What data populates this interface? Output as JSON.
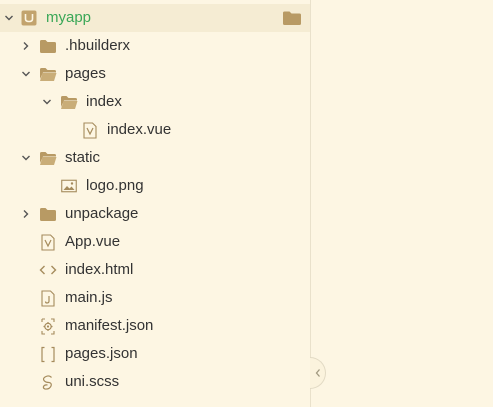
{
  "project": {
    "name": "myapp"
  },
  "tree": {
    "hbuilderx": ".hbuilderx",
    "pages": "pages",
    "index_folder": "index",
    "index_vue": "index.vue",
    "static": "static",
    "logo": "logo.png",
    "unpackage": "unpackage",
    "app_vue": "App.vue",
    "index_html": "index.html",
    "main_js": "main.js",
    "manifest": "manifest.json",
    "pages_json": "pages.json",
    "uni_scss": "uni.scss"
  },
  "colors": {
    "background": "#fdf6e3",
    "root_highlight": "#f5ecd3",
    "project_name": "#3aa757",
    "folder": "#b89a64",
    "file_icon": "#a58b5c"
  },
  "icons": {
    "root": "uniapp-project-icon",
    "folder": "folder-icon",
    "vue": "vue-file-icon",
    "image": "image-file-icon",
    "html": "code-file-icon",
    "js": "js-file-icon",
    "json_manifest": "manifest-icon",
    "json": "json-file-icon",
    "scss": "scss-file-icon"
  }
}
